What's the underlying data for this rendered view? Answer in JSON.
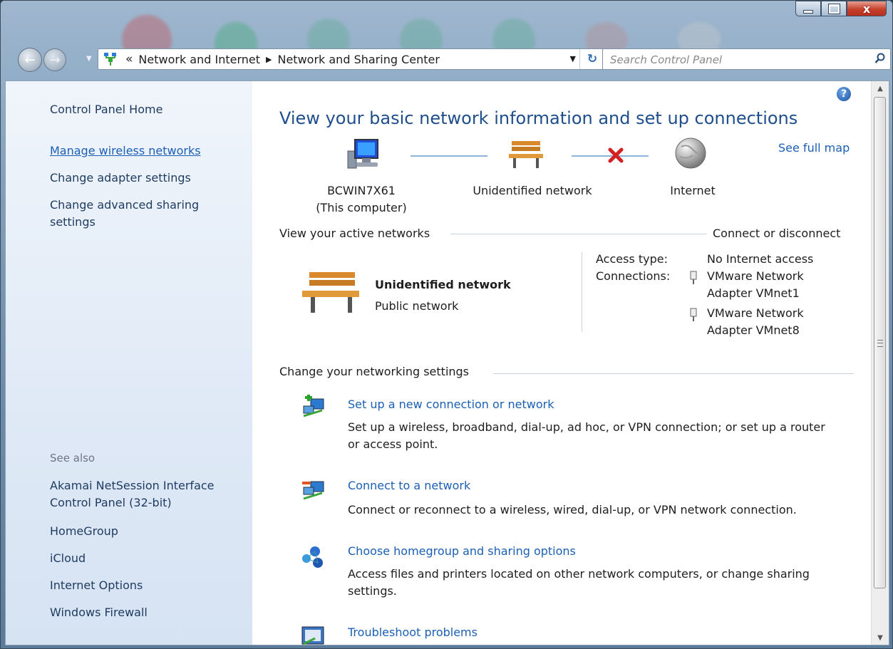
{
  "window": {
    "caption_buttons": {
      "close_glyph": "x"
    }
  },
  "navigation": {
    "breadcrumb": {
      "overflow_chevron": "«",
      "items": [
        "Network and Internet",
        "Network and Sharing Center"
      ]
    },
    "search_placeholder": "Search Control Panel"
  },
  "sidebar": {
    "home_link": "Control Panel Home",
    "links": [
      "Manage wireless networks",
      "Change adapter settings",
      "Change advanced sharing settings"
    ],
    "see_also_heading": "See also",
    "see_also_links": [
      "Akamai NetSession Interface Control Panel (32-bit)",
      "HomeGroup",
      "iCloud",
      "Internet Options",
      "Windows Firewall"
    ]
  },
  "main": {
    "title": "View your basic network information and set up connections",
    "see_full_map": "See full map",
    "map": {
      "computer_name": "BCWIN7X61",
      "computer_sub": "(This computer)",
      "network_name": "Unidentified network",
      "internet_label": "Internet"
    },
    "active_networks": {
      "heading": "View your active networks",
      "connect_link": "Connect or disconnect",
      "network_name": "Unidentified network",
      "network_type": "Public network",
      "access_type_label": "Access type:",
      "access_type_value": "No Internet access",
      "connections_label": "Connections:",
      "connections": [
        "VMware Network Adapter VMnet1",
        "VMware Network Adapter VMnet8"
      ]
    },
    "change_settings": {
      "heading": "Change your networking settings",
      "tasks": [
        {
          "title": "Set up a new connection or network",
          "desc": "Set up a wireless, broadband, dial-up, ad hoc, or VPN connection; or set up a router or access point.",
          "icon": "new-connection-icon"
        },
        {
          "title": "Connect to a network",
          "desc": "Connect or reconnect to a wireless, wired, dial-up, or VPN network connection.",
          "icon": "connect-network-icon"
        },
        {
          "title": "Choose homegroup and sharing options",
          "desc": "Access files and printers located on other network computers, or change sharing settings.",
          "icon": "homegroup-icon"
        },
        {
          "title": "Troubleshoot problems",
          "desc": "",
          "icon": "troubleshoot-icon"
        }
      ]
    }
  },
  "colors": {
    "link": "#1b5fb5",
    "title": "#1f4e8c",
    "sidebar_bg": "#dfe9f6",
    "disconnect_x": "#d42020"
  }
}
